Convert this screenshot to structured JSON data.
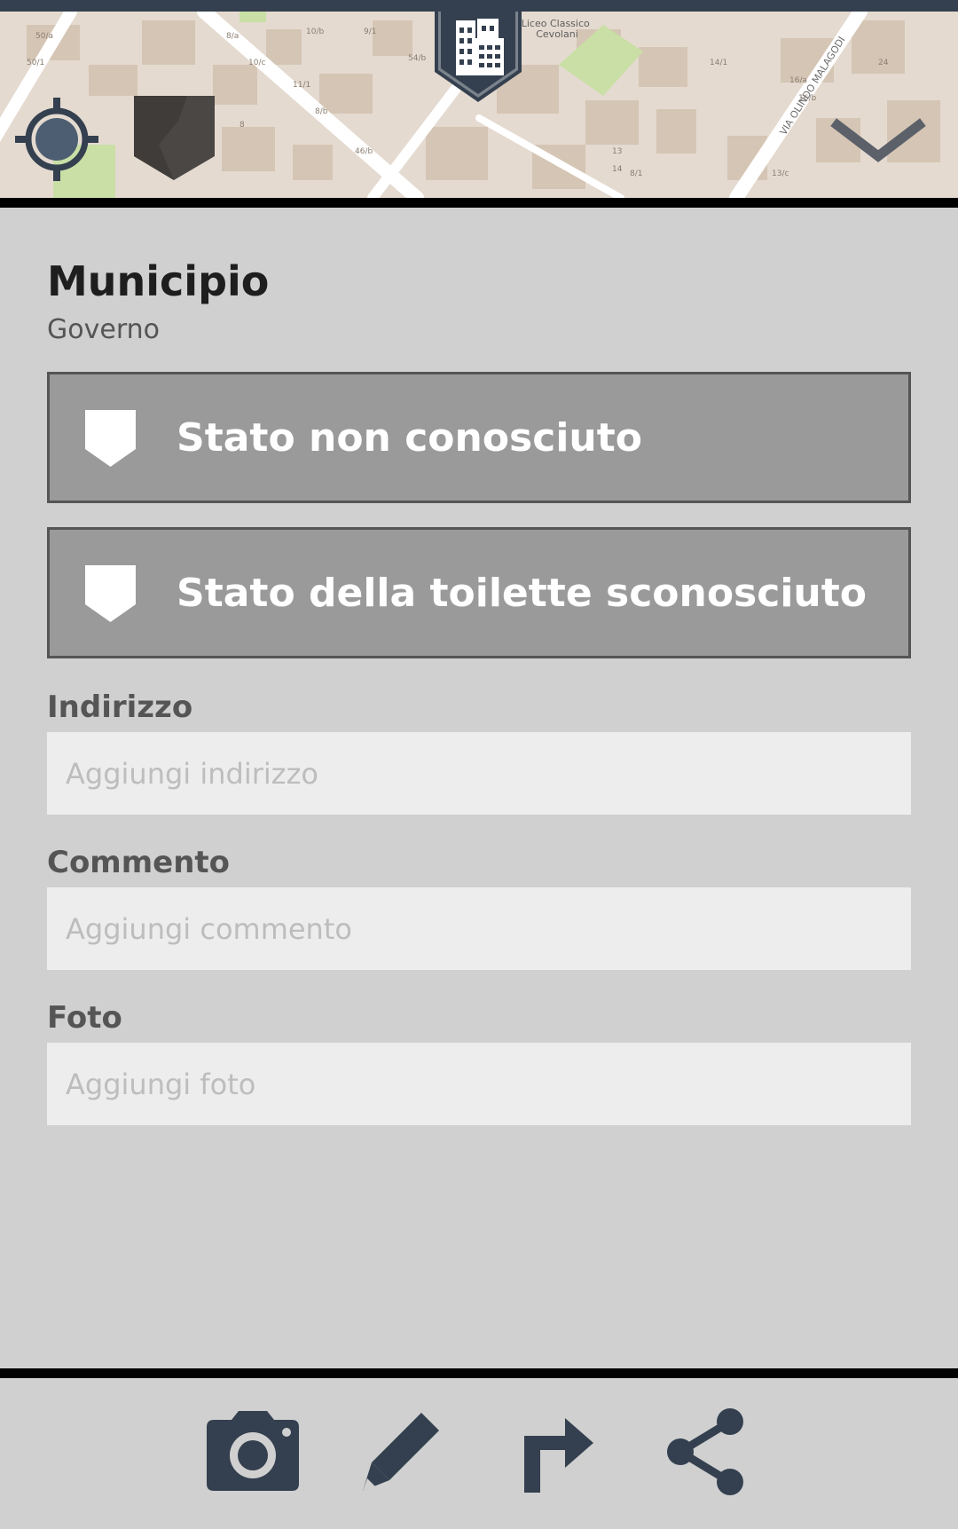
{
  "map": {
    "labels": {
      "poi": "Liceo Classico\nCevolani",
      "street": "VIA OLINDO MALAGODI"
    },
    "house_numbers": [
      "50/a",
      "50/1",
      "8/a",
      "10/b",
      "10/c",
      "9/1",
      "11/1",
      "8/b",
      "8",
      "54/b",
      "46/b",
      "14/1",
      "14",
      "13",
      "8/1",
      "16/a",
      "16/b",
      "24",
      "13/c"
    ],
    "locate_icon": "crosshair-icon",
    "layer_icon": "location-badge-icon",
    "marker_icon": "building-icon",
    "collapse_icon": "chevron-down-icon"
  },
  "poi": {
    "title": "Municipio",
    "category": "Governo"
  },
  "status_buttons": [
    {
      "label": "Stato non conosciuto",
      "icon": "shield-badge-icon"
    },
    {
      "label": "Stato della toilette sconosciuto",
      "icon": "shield-badge-icon"
    }
  ],
  "fields": {
    "address": {
      "label": "Indirizzo",
      "placeholder": "Aggiungi indirizzo",
      "value": ""
    },
    "comment": {
      "label": "Commento",
      "placeholder": "Aggiungi commento",
      "value": ""
    },
    "photo": {
      "label": "Foto",
      "placeholder": "Aggiungi foto",
      "value": ""
    }
  },
  "actions": [
    {
      "name": "camera",
      "icon": "camera-icon"
    },
    {
      "name": "edit",
      "icon": "pencil-icon"
    },
    {
      "name": "route",
      "icon": "turn-right-arrow-icon"
    },
    {
      "name": "share",
      "icon": "share-icon"
    }
  ],
  "colors": {
    "top_bar": "#34404f",
    "icon_dark": "#34404f",
    "background": "#d0d0d0",
    "status_button": "#9a9a9a",
    "input_background": "#ededed",
    "map_background": "#e4dad0",
    "map_building": "#d5c5b4",
    "map_park": "#c9dfa5"
  }
}
